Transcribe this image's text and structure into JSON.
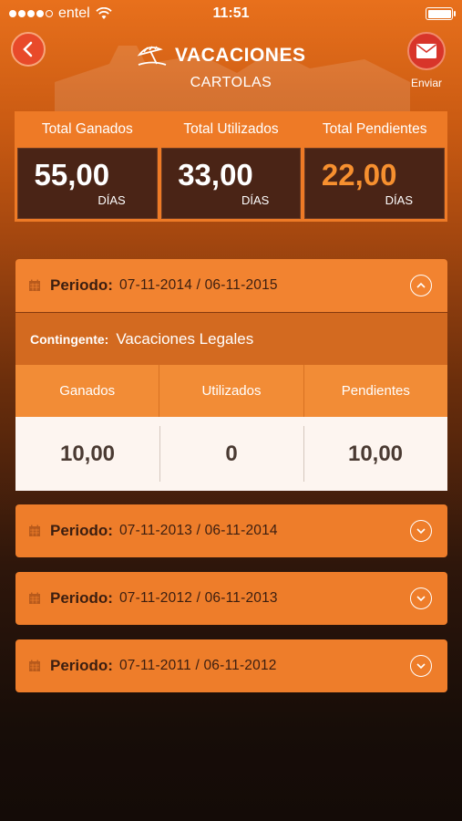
{
  "status_bar": {
    "carrier": "entel",
    "time": "11:51"
  },
  "header": {
    "title": "VACACIONES",
    "subtitle": "CARTOLAS",
    "send_label": "Enviar"
  },
  "totals": [
    {
      "label": "Total Ganados",
      "value": "55,00",
      "unit": "DÍAS"
    },
    {
      "label": "Total Utilizados",
      "value": "33,00",
      "unit": "DÍAS"
    },
    {
      "label": "Total Pendientes",
      "value": "22,00",
      "unit": "DÍAS"
    }
  ],
  "periods": [
    {
      "label": "Periodo:",
      "dates": "07-11-2014 / 06-11-2015",
      "expanded": true
    },
    {
      "label": "Periodo:",
      "dates": "07-11-2013 / 06-11-2014",
      "expanded": false
    },
    {
      "label": "Periodo:",
      "dates": "07-11-2012 / 06-11-2013",
      "expanded": false
    },
    {
      "label": "Periodo:",
      "dates": "07-11-2011 / 06-11-2012",
      "expanded": false
    }
  ],
  "detail": {
    "contingente_label": "Contingente:",
    "contingente_value": "Vacaciones Legales",
    "headers": [
      "Ganados",
      "Utilizados",
      "Pendientes"
    ],
    "values": [
      "10,00",
      "0",
      "10,00"
    ]
  },
  "colors": {
    "accent_orange": "#ee7d2a",
    "pending_orange": "#f7902f",
    "back_button": "#e84a2a",
    "send_button": "#d8352a"
  }
}
